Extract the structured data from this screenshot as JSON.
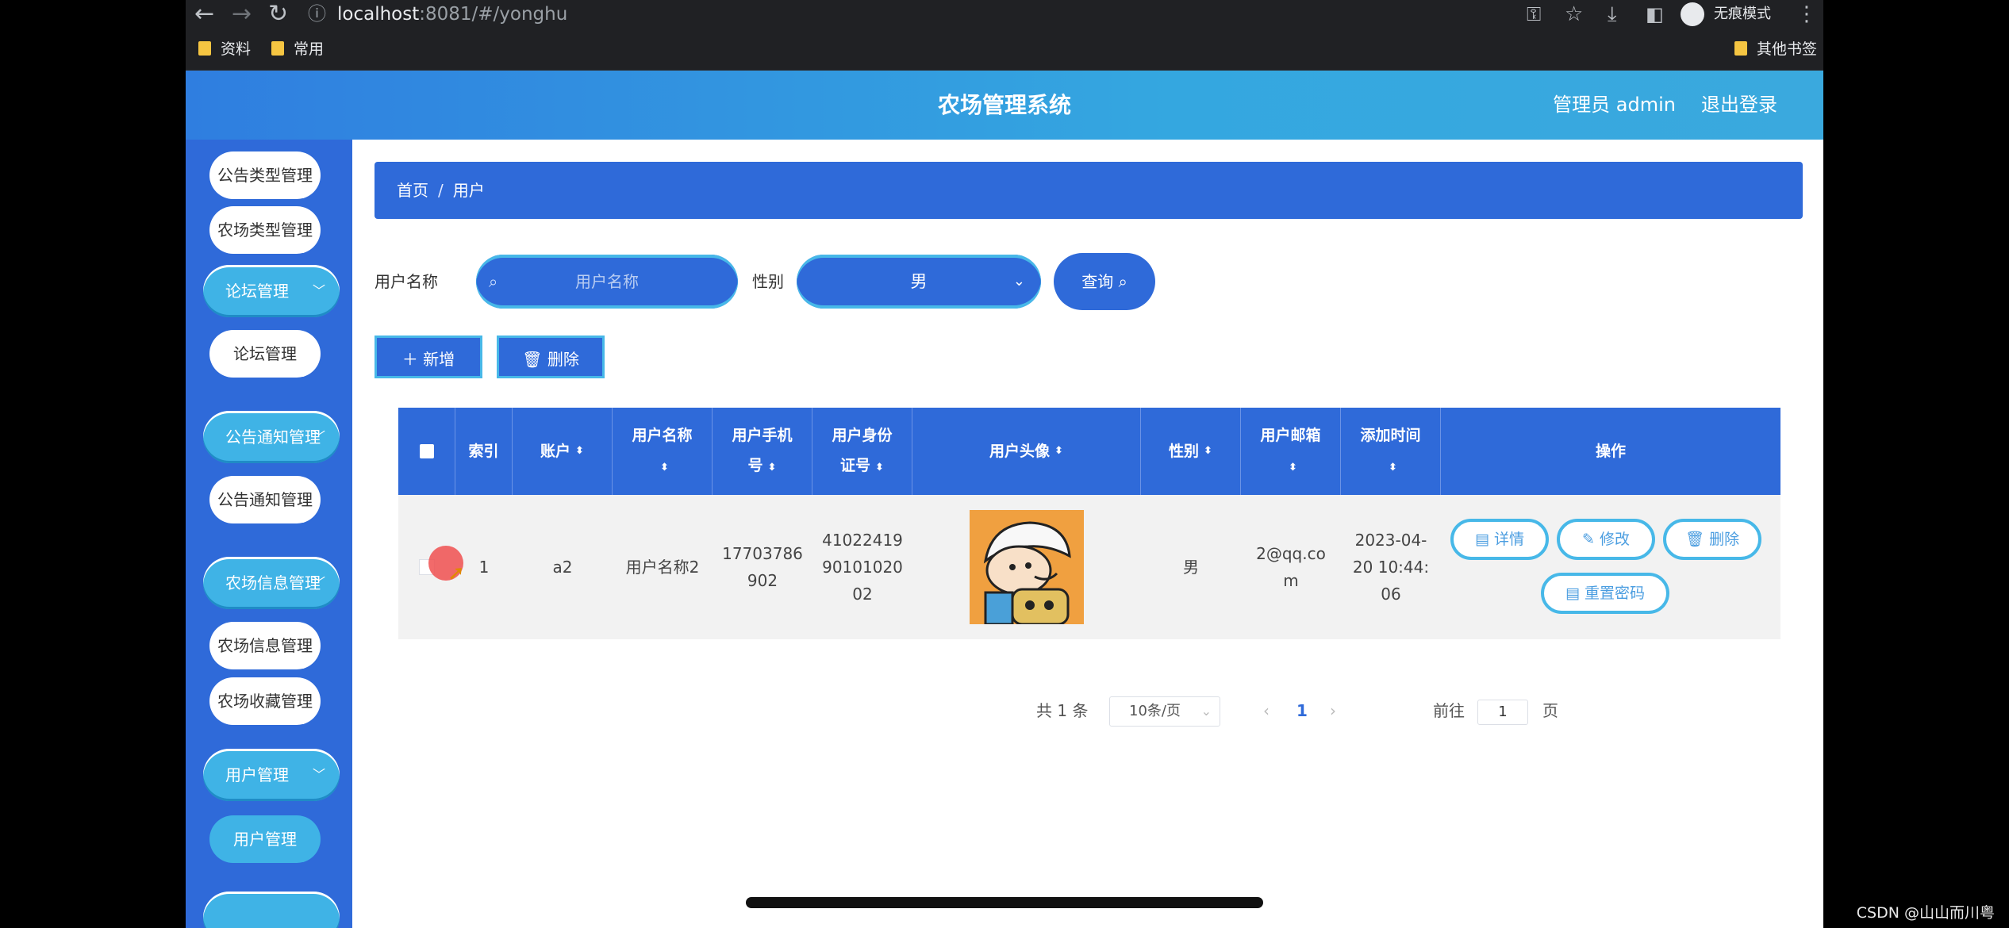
{
  "browser": {
    "url_host": "localhost",
    "url_path": ":8081/#/yonghu",
    "incognito_label": "无痕模式",
    "bookmarks": [
      "资料",
      "常用"
    ],
    "other_bookmarks": "其他书签"
  },
  "header": {
    "title": "农场管理系统",
    "admin_label": "管理员 admin",
    "logout_label": "退出登录"
  },
  "sidebar": {
    "items": [
      {
        "label": "公告类型管理",
        "kind": "item"
      },
      {
        "label": "农场类型管理",
        "kind": "item"
      },
      {
        "label": "论坛管理",
        "kind": "group"
      },
      {
        "label": "论坛管理",
        "kind": "item"
      },
      {
        "label": "公告通知管理",
        "kind": "group"
      },
      {
        "label": "公告通知管理",
        "kind": "item"
      },
      {
        "label": "农场信息管理",
        "kind": "group"
      },
      {
        "label": "农场信息管理",
        "kind": "item"
      },
      {
        "label": "农场收藏管理",
        "kind": "item"
      },
      {
        "label": "用户管理",
        "kind": "group"
      },
      {
        "label": "用户管理",
        "kind": "item_active"
      }
    ]
  },
  "breadcrumb": {
    "home": "首页",
    "sep": "/",
    "current": "用户"
  },
  "search": {
    "name_label": "用户名称",
    "name_placeholder": "用户名称",
    "gender_label": "性别",
    "gender_value": "男",
    "query_label": "查询"
  },
  "actions": {
    "add_label": "新增",
    "delete_label": "删除"
  },
  "table": {
    "headers": {
      "index": "索引",
      "account": "账户",
      "username": "用户名称",
      "phone_l1": "用户手机",
      "phone_l2": "号",
      "idcard_l1": "用户身份",
      "idcard_l2": "证号",
      "avatar": "用户头像",
      "gender": "性别",
      "email_l1": "用户邮箱",
      "time_l1": "添加时间",
      "ops": "操作"
    },
    "rows": [
      {
        "index": "1",
        "account": "a2",
        "username": "用户名称2",
        "phone_l1": "17703786",
        "phone_l2": "902",
        "idcard_l1": "41022419",
        "idcard_l2": "90101020",
        "idcard_l3": "02",
        "gender": "男",
        "email_l1": "2@qq.co",
        "email_l2": "m",
        "time_l1": "2023-04-",
        "time_l2": "20 10:44:",
        "time_l3": "06",
        "ops": {
          "detail": "详情",
          "edit": "修改",
          "delete": "删除",
          "reset": "重置密码"
        }
      }
    ]
  },
  "pagination": {
    "total_text": "共 1 条",
    "page_size": "10条/页",
    "current_page": "1",
    "goto_prefix": "前往",
    "goto_value": "1",
    "goto_suffix": "页"
  },
  "watermark": "CSDN @山山而川粤",
  "colors": {
    "primary": "#2f6ad9",
    "accent": "#47b8e8"
  }
}
